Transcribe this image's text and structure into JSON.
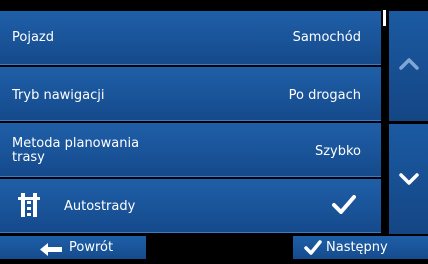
{
  "settings": [
    {
      "label": "Pojazd",
      "value": "Samochód"
    },
    {
      "label": "Tryb nawigacji",
      "value": "Po drogach"
    },
    {
      "label_line1": "Metoda planowania",
      "label_line2": "trasy",
      "value": "Szybko"
    },
    {
      "label": "Autostrady",
      "checked": true,
      "icon": "highway-icon"
    }
  ],
  "nav": {
    "back_label": "Powrót",
    "next_label": "Następny"
  },
  "colors": {
    "row_blue": "#1a559a",
    "background": "#000000"
  }
}
